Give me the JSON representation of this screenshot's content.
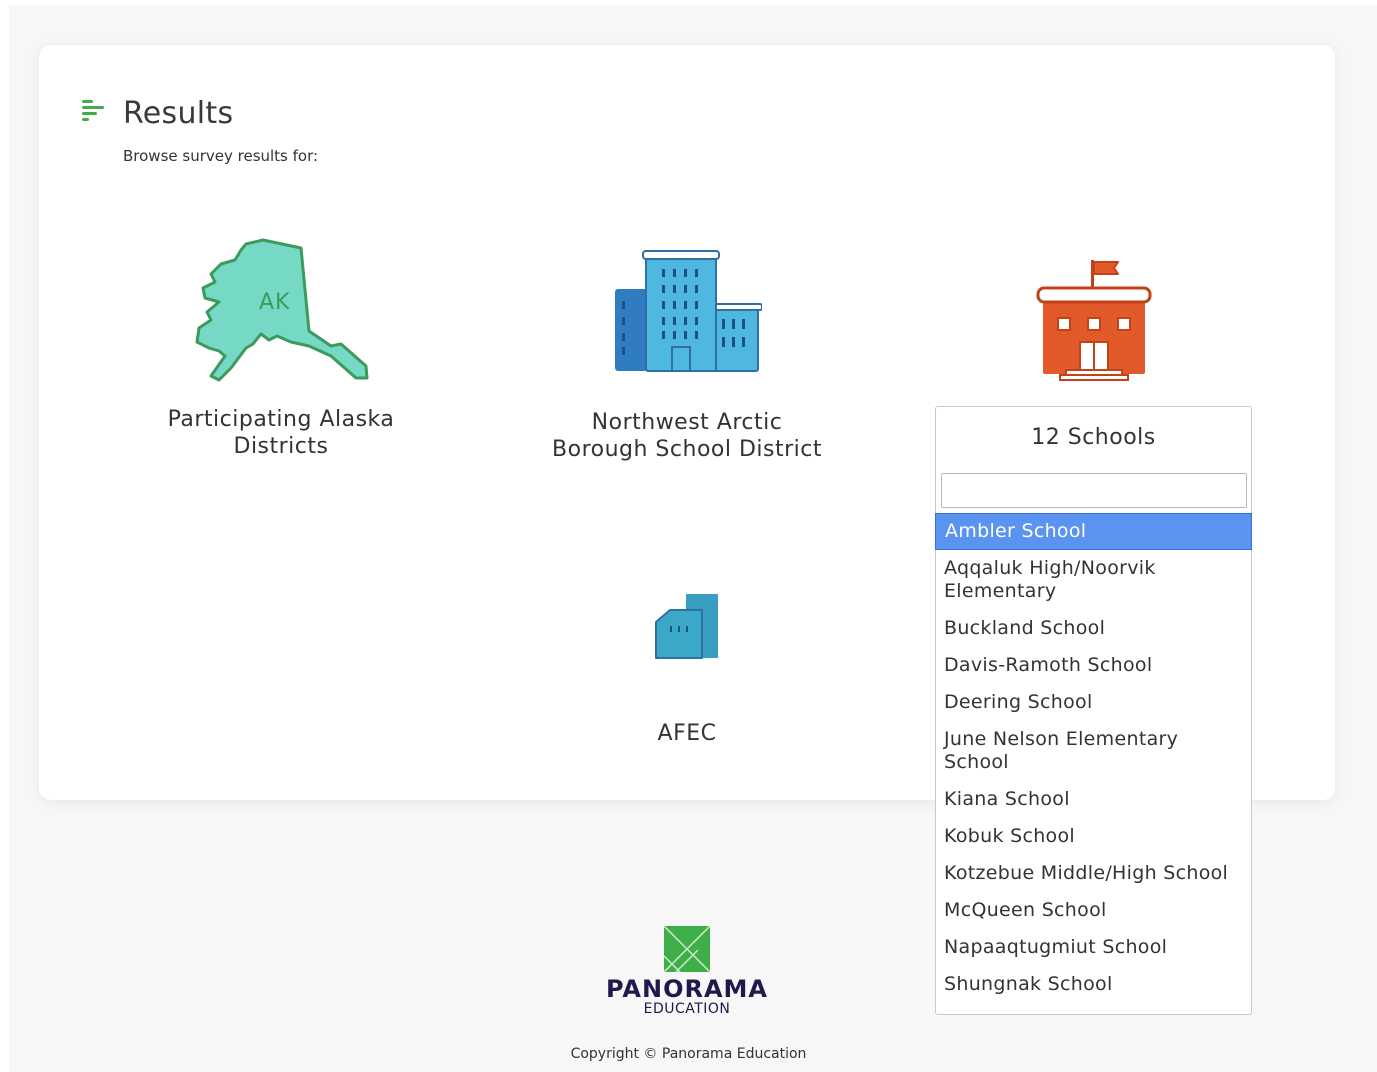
{
  "header": {
    "title": "Results",
    "subtitle": "Browse survey results for:"
  },
  "tiles": [
    {
      "label_line1": "Participating Alaska",
      "label_line2": "Districts",
      "state_abbrev": "AK"
    },
    {
      "label_line1": "Northwest Arctic",
      "label_line2": "Borough School District"
    },
    {
      "label": "AFEC"
    }
  ],
  "dropdown": {
    "title": "12 Schools",
    "search_value": "",
    "items": [
      "Ambler School",
      "Aqqaluk High/Noorvik Elementary",
      "Buckland School",
      "Davis-Ramoth School",
      "Deering School",
      "June Nelson Elementary School",
      "Kiana School",
      "Kobuk School",
      "Kotzebue Middle/High School",
      "McQueen School",
      "Napaaqtugmiut School",
      "Shungnak School"
    ],
    "selected_index": 0
  },
  "footer": {
    "brand_name": "PANORAMA",
    "brand_sub": "EDUCATION",
    "copyright": "Copyright © Panorama Education"
  },
  "colors": {
    "accent_green": "#3fae49",
    "alaska_fill": "#76d9c6",
    "alaska_stroke": "#3c9a5b",
    "building_blue": "#4fb8e0",
    "building_dark": "#2f6fa8",
    "school_orange": "#e35a2a",
    "selected_blue": "#5b93f0",
    "brand_navy": "#1e1a4d"
  },
  "icons": {
    "results": "results-list-icon",
    "state": "alaska-map-icon",
    "district": "district-buildings-icon",
    "school": "school-building-icon",
    "afec": "small-building-icon",
    "brand": "panorama-logo-icon"
  }
}
